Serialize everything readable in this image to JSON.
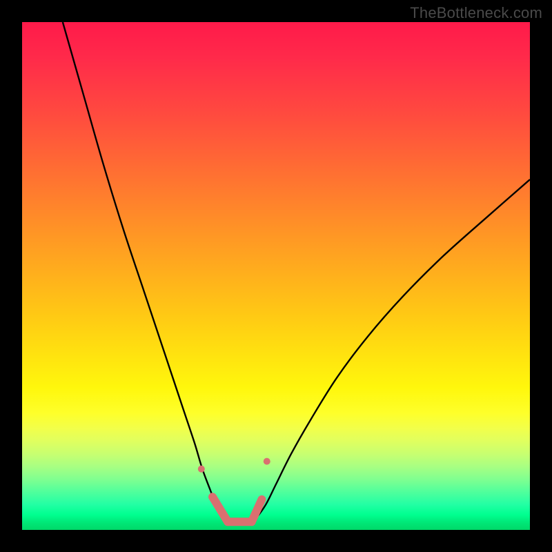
{
  "watermark": "TheBottleneck.com",
  "colors": {
    "background": "#000000",
    "curve": "#000000",
    "marker_fill": "#d97070",
    "marker_stroke": "#d97070"
  },
  "chart_data": {
    "type": "line",
    "title": "",
    "xlabel": "",
    "ylabel": "",
    "xlim": [
      0,
      100
    ],
    "ylim": [
      0,
      100
    ],
    "series": [
      {
        "name": "left-curve",
        "x": [
          8,
          12,
          16,
          20,
          24,
          28,
          30,
          32,
          34,
          35.5,
          37,
          38,
          39,
          40,
          41
        ],
        "y": [
          100,
          86,
          72,
          59,
          47,
          35,
          29,
          23,
          17,
          12,
          8,
          5.5,
          3.5,
          2,
          1.2
        ]
      },
      {
        "name": "right-curve",
        "x": [
          45,
          46,
          48,
          50,
          53,
          57,
          62,
          68,
          75,
          83,
          92,
          100
        ],
        "y": [
          1.2,
          2.2,
          5,
          9,
          15,
          22,
          30,
          38,
          46,
          54,
          62,
          69
        ]
      },
      {
        "name": "flat-minimum",
        "x": [
          41,
          42,
          43,
          44,
          45
        ],
        "y": [
          1.2,
          1.0,
          1.0,
          1.0,
          1.2
        ]
      }
    ],
    "markers": [
      {
        "shape": "dot",
        "x": 35.3,
        "y": 12.0,
        "r": 5
      },
      {
        "shape": "dot",
        "x": 48.2,
        "y": 13.5,
        "r": 5
      },
      {
        "shape": "thick-segment",
        "from": {
          "x": 37.5,
          "y": 6.5
        },
        "to": {
          "x": 40.5,
          "y": 1.6
        },
        "w": 12
      },
      {
        "shape": "thick-segment",
        "from": {
          "x": 40.5,
          "y": 1.6
        },
        "to": {
          "x": 45.2,
          "y": 1.6
        },
        "w": 12
      },
      {
        "shape": "thick-segment",
        "from": {
          "x": 45.2,
          "y": 1.6
        },
        "to": {
          "x": 47.2,
          "y": 6.0
        },
        "w": 12
      }
    ],
    "annotations": []
  }
}
